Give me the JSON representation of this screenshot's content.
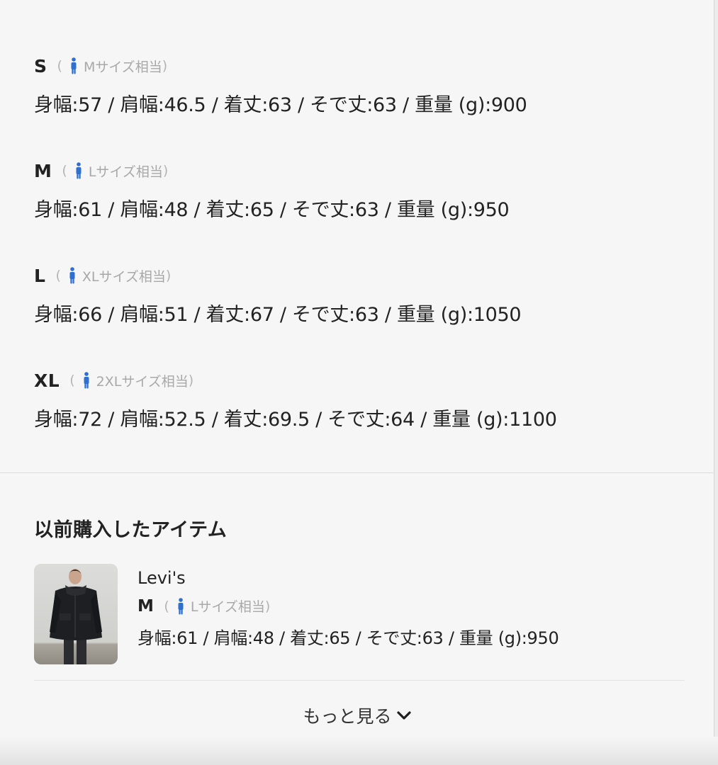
{
  "sizes": [
    {
      "label": "S",
      "equivalent": "Mサイズ相当",
      "measurements": "身幅:57 / 肩幅:46.5 / 着丈:63 / そで丈:63 / 重量 (g):900"
    },
    {
      "label": "M",
      "equivalent": "Lサイズ相当",
      "measurements": "身幅:61 / 肩幅:48 / 着丈:65 / そで丈:63 / 重量 (g):950"
    },
    {
      "label": "L",
      "equivalent": "XLサイズ相当",
      "measurements": "身幅:66 / 肩幅:51 / 着丈:67 / そで丈:63 / 重量 (g):1050"
    },
    {
      "label": "XL",
      "equivalent": "2XLサイズ相当",
      "measurements": "身幅:72 / 肩幅:52.5 / 着丈:69.5 / そで丈:64 / 重量 (g):1100"
    }
  ],
  "paren_open": "(",
  "paren_close": ")",
  "previous_purchase": {
    "title": "以前購入したアイテム",
    "item": {
      "brand": "Levi's",
      "size_label": "M",
      "equivalent": "Lサイズ相当",
      "measurements": "身幅:61 / 肩幅:48 / 着丈:65 / そで丈:63 / 重量 (g):950"
    },
    "more_label": "もっと見る"
  },
  "colors": {
    "person_icon": "#2f6fd0",
    "background": "#f6f6f6"
  },
  "icons": {
    "person": "person-icon",
    "chevron": "chevron-down-icon"
  }
}
